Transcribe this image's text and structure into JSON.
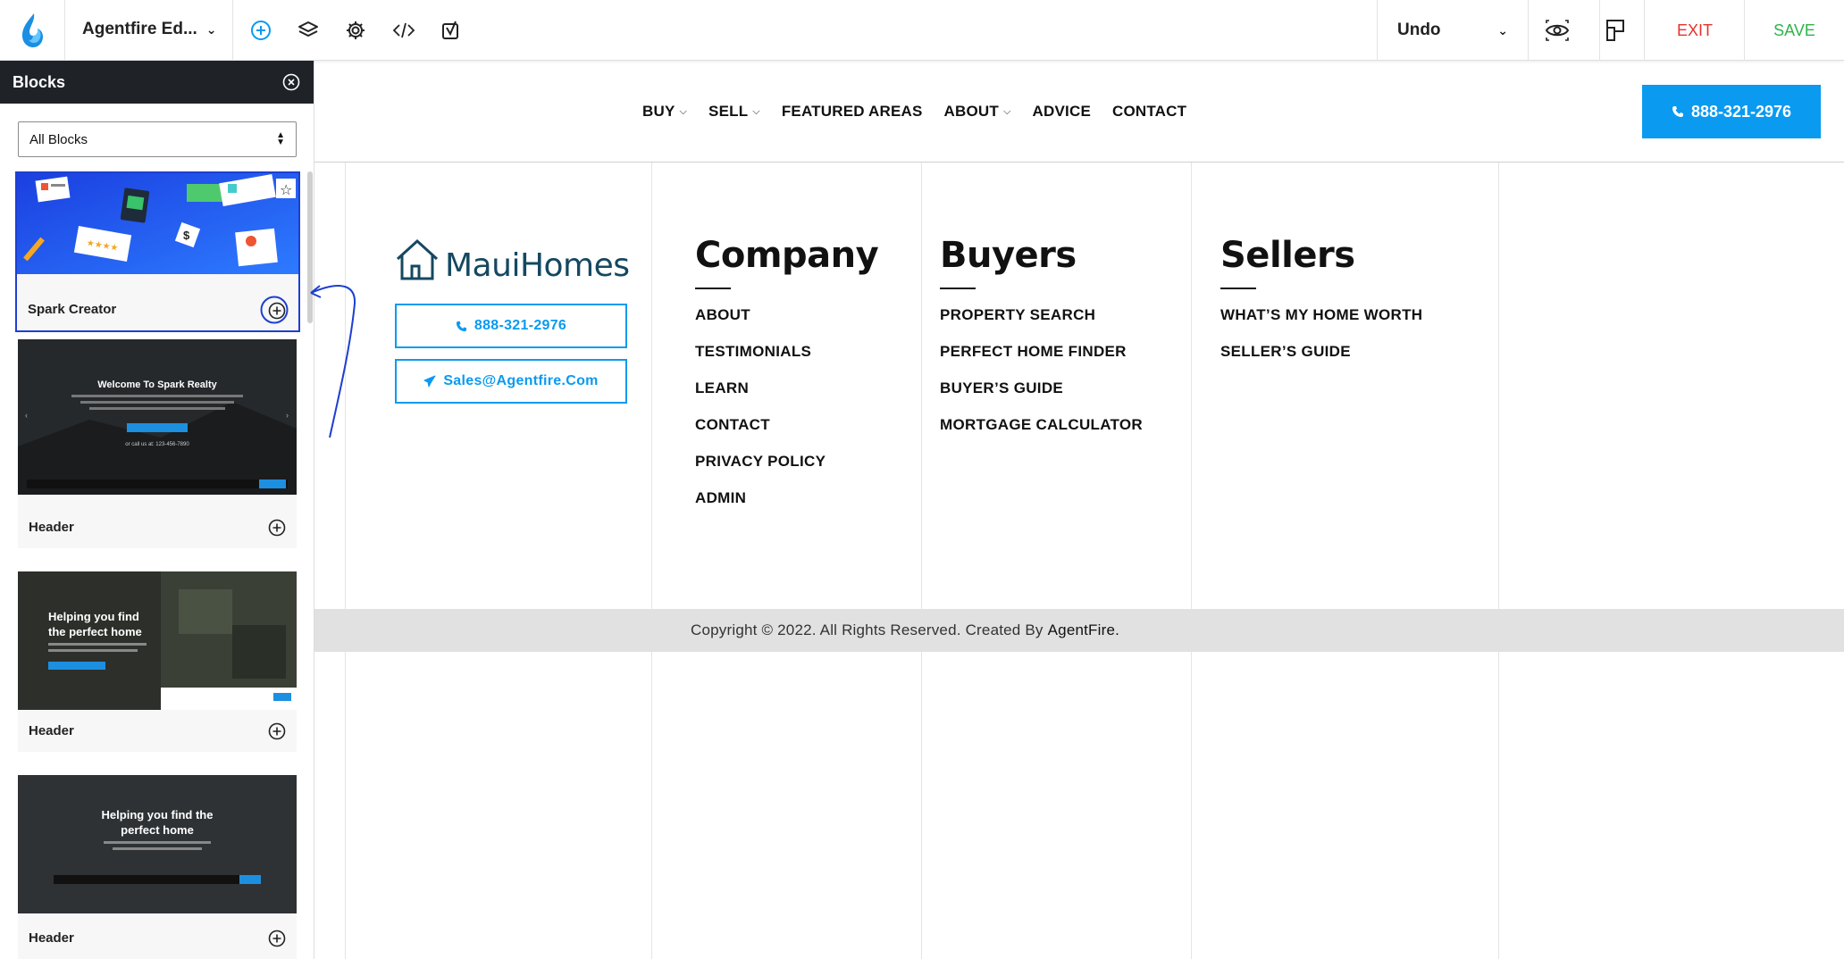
{
  "toolbar": {
    "title": "Agentfire Ed...",
    "undo_label": "Undo",
    "exit_label": "EXIT",
    "save_label": "SAVE",
    "icons": [
      "add-block-icon",
      "layers-icon",
      "gear-icon",
      "code-icon",
      "yoast-icon",
      "preview-eye-icon",
      "responsive-view-icon"
    ],
    "colors": {
      "exit": "#e5322d",
      "save": "#2fb44a",
      "accent": "#0a9af0"
    }
  },
  "panel": {
    "title": "Blocks",
    "filter_value": "All Blocks",
    "cards": [
      {
        "label": "Spark Creator"
      },
      {
        "label": "Header",
        "preview_title": "Welcome To Spark Realty",
        "preview_sub": "or call us at: 123-456-7890"
      },
      {
        "label": "Header",
        "preview_title": "Helping you find the perfect home"
      },
      {
        "label": "Header",
        "preview_title": "Helping you find the perfect home"
      }
    ]
  },
  "site": {
    "nav": [
      {
        "label": "BUY",
        "dropdown": true
      },
      {
        "label": "SELL",
        "dropdown": true
      },
      {
        "label": "FEATURED AREAS",
        "dropdown": false
      },
      {
        "label": "ABOUT",
        "dropdown": true
      },
      {
        "label": "ADVICE",
        "dropdown": false
      },
      {
        "label": "CONTACT",
        "dropdown": false
      }
    ],
    "nav_phone": "888-321-2976",
    "brand": "MauiHomes",
    "footer_phone": "888-321-2976",
    "footer_email": "Sales@Agentfire.Com",
    "columns": [
      {
        "title": "Company",
        "links": [
          "ABOUT",
          "TESTIMONIALS",
          "LEARN",
          "CONTACT",
          "PRIVACY POLICY",
          "ADMIN"
        ]
      },
      {
        "title": "Buyers",
        "links": [
          "PROPERTY SEARCH",
          "PERFECT HOME FINDER",
          "BUYER’S GUIDE",
          "MORTGAGE CALCULATOR"
        ]
      },
      {
        "title": "Sellers",
        "links": [
          "WHAT’S MY HOME WORTH",
          "SELLER’S GUIDE"
        ]
      }
    ],
    "copyright": "Copyright © 2022. All Rights Reserved. Created By",
    "copyright_link": "AgentFire."
  }
}
